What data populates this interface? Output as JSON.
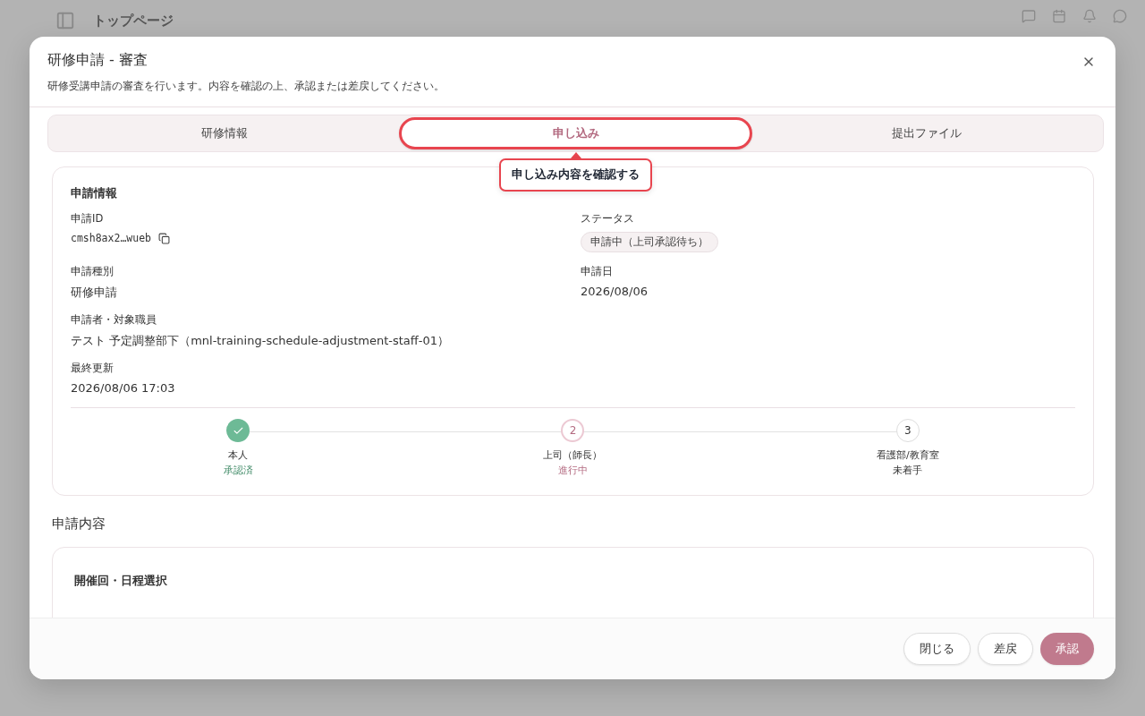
{
  "background": {
    "page_title": "トップページ"
  },
  "dialog": {
    "title": "研修申請 - 審査",
    "description": "研修受講申請の審査を行います。内容を確認の上、承認または差戻してください。"
  },
  "tabs": [
    {
      "label": "研修情報",
      "selected": false
    },
    {
      "label": "申し込み",
      "selected": true,
      "highlighted": true
    },
    {
      "label": "提出ファイル",
      "selected": false
    }
  ],
  "tooltip": "申し込み内容を確認する",
  "info_card": {
    "title": "申請情報",
    "fields": [
      {
        "label": "申請ID",
        "value": "cmsh8ax2…wueb",
        "kind": "id"
      },
      {
        "label": "ステータス",
        "value": "申請中（上司承認待ち）",
        "kind": "badge"
      },
      {
        "label": "申請種別",
        "value": "研修申請",
        "kind": "text"
      },
      {
        "label": "申請日",
        "value": "2026/08/06",
        "kind": "text"
      },
      {
        "label": "申請者・対象職員",
        "value": "テスト 予定調整部下（mnl-training-schedule-adjustment-staff-01）",
        "kind": "wide"
      },
      {
        "label": "最終更新",
        "value": "2026/08/06 17:03",
        "kind": "wide"
      }
    ],
    "steps": [
      {
        "name": "本人",
        "status": "承認済",
        "completed": true,
        "current": false
      },
      {
        "marker": "2",
        "name": "上司（師長）",
        "status": "進行中",
        "completed": false,
        "current": true
      },
      {
        "marker": "3",
        "name": "看護部/教育室",
        "status": "未着手",
        "completed": false,
        "current": false
      }
    ]
  },
  "section_title": "申請内容",
  "content_card": {
    "title": "開催回・日程選択"
  },
  "buttons": [
    {
      "label": "閉じる",
      "kind": "outline"
    },
    {
      "label": "差戻",
      "kind": "outline"
    },
    {
      "label": "承認",
      "kind": "primary"
    }
  ]
}
